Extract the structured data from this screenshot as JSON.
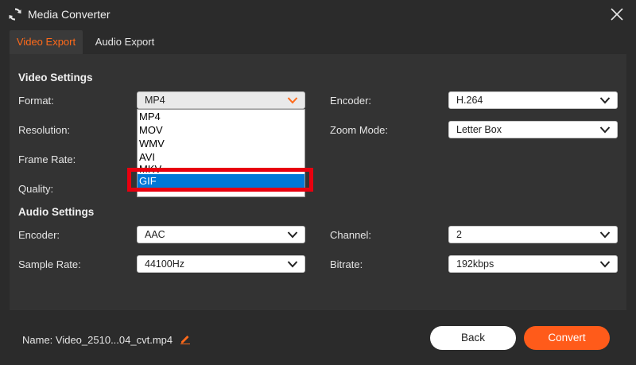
{
  "app": {
    "title": "Media Converter"
  },
  "tabs": [
    {
      "label": "Video Export"
    },
    {
      "label": "Audio Export"
    }
  ],
  "video_settings": {
    "title": "Video Settings",
    "format": {
      "label": "Format:",
      "value": "MP4"
    },
    "resolution": {
      "label": "Resolution:"
    },
    "frame_rate": {
      "label": "Frame Rate:"
    },
    "quality": {
      "label": "Quality:"
    },
    "encoder": {
      "label": "Encoder:",
      "value": "H.264"
    },
    "zoom_mode": {
      "label": "Zoom Mode:",
      "value": "Letter Box"
    }
  },
  "format_dropdown": {
    "options": [
      "MP4",
      "MOV",
      "WMV",
      "AVI",
      "MKV",
      "GIF"
    ],
    "highlighted": "GIF"
  },
  "audio_settings": {
    "title": "Audio Settings",
    "encoder": {
      "label": "Encoder:",
      "value": "AAC"
    },
    "sample_rate": {
      "label": "Sample Rate:",
      "value": "44100Hz"
    },
    "channel": {
      "label": "Channel:",
      "value": "2"
    },
    "bitrate": {
      "label": "Bitrate:",
      "value": "192kbps"
    }
  },
  "footer": {
    "name_text": "Name: Video_2510...04_cvt.mp4",
    "back_label": "Back",
    "convert_label": "Convert"
  },
  "colors": {
    "accent": "#ff5b1a",
    "highlight_box": "#e8000f",
    "selection": "#0078d7"
  }
}
